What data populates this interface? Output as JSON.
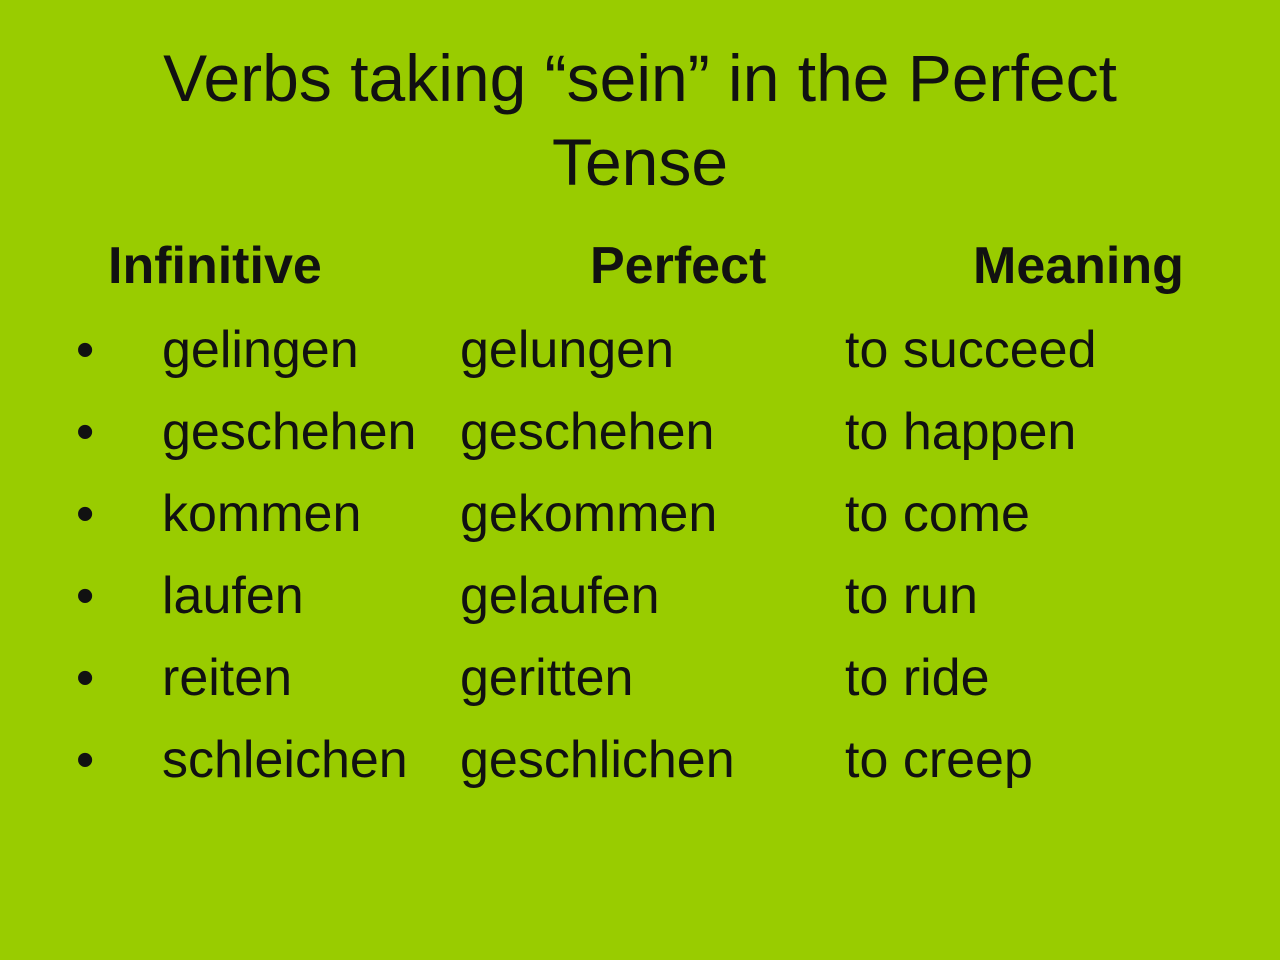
{
  "title": {
    "line1": "Verbs taking “sein” in the Perfect",
    "line2": "Tense"
  },
  "headers": {
    "infinitive": "Infinitive",
    "perfect": "Perfect",
    "meaning": "Meaning"
  },
  "bullet": "•",
  "rows": [
    {
      "infinitive": "gelingen",
      "perfect": "gelungen",
      "meaning": "to succeed"
    },
    {
      "infinitive": "geschehen",
      "perfect": "geschehen",
      "meaning": "to happen"
    },
    {
      "infinitive": "kommen",
      "perfect": "gekommen",
      "meaning": "to come"
    },
    {
      "infinitive": "laufen",
      "perfect": "gelaufen",
      "meaning": "to run"
    },
    {
      "infinitive": "reiten",
      "perfect": "geritten",
      "meaning": "to ride"
    },
    {
      "infinitive": "schleichen",
      "perfect": "geschlichen",
      "meaning": "to creep"
    }
  ],
  "colors": {
    "background": "#99cc00",
    "text": "#111111"
  }
}
